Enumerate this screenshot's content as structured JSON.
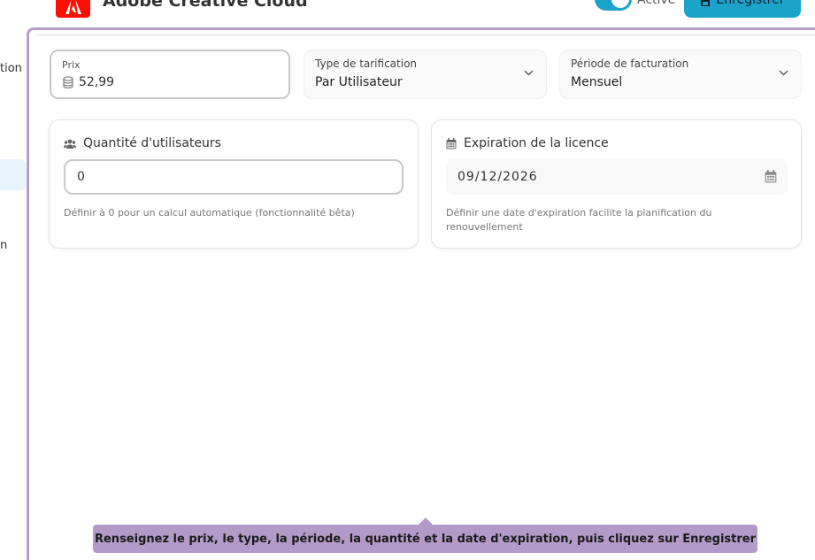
{
  "sidebar": {
    "item_top_label": "tion",
    "item_bottom_label": "n"
  },
  "header": {
    "app_name": "Adobe Creative Cloud",
    "status_label": "Active",
    "status_active": true,
    "save_label": "Enregistrer"
  },
  "form": {
    "price": {
      "label": "Prix",
      "value": "52,99"
    },
    "pricing_type": {
      "label": "Type de tarification",
      "value": "Par Utilisateur"
    },
    "billing_period": {
      "label": "Période de facturation",
      "value": "Mensuel"
    }
  },
  "user_quantity": {
    "title": "Quantité d'utilisateurs",
    "value": "0",
    "help": "Définir à 0 pour un calcul automatique (fonctionnalité bêta)"
  },
  "license_expiration": {
    "title": "Expiration de la licence",
    "value": "09/12/2026",
    "help": "Définir une date d'expiration facilite la planification du renouvellement"
  },
  "tooltip": {
    "text": "Renseignez le prix, le type, la période, la quantité et la date d'expiration, puis cliquez sur Enregistrer"
  },
  "colors": {
    "accent": "#1ba3c9",
    "highlight": "#b79dcc",
    "adobe_red": "#fa0f00"
  }
}
